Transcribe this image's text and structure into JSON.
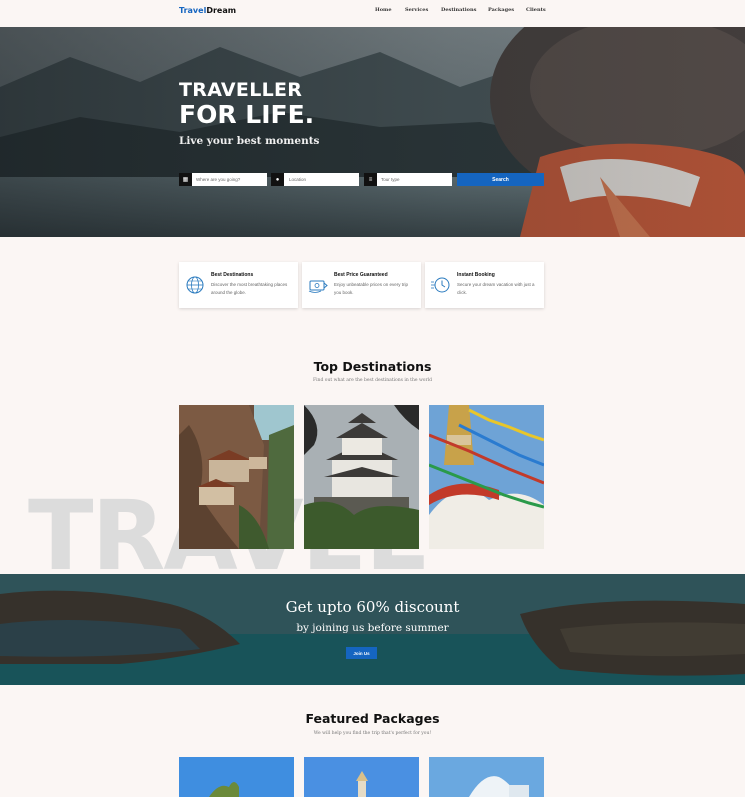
{
  "nav": {
    "logo_part1": "Travel",
    "logo_part2": "Dream",
    "items": [
      "Home",
      "Services",
      "Destinations",
      "Packages",
      "Clients"
    ]
  },
  "hero": {
    "title_line1": "TRAVELLER",
    "title_line2": "FOR LIFE.",
    "subtitle": "Live your best moments",
    "search": {
      "destination_placeholder": "Where are you going?",
      "location_placeholder": "Location",
      "tour_type_placeholder": "Tour type",
      "button_label": "Search"
    }
  },
  "features": [
    {
      "title": "Best Destinations",
      "description": "Discover the most breathtaking places around the globe.",
      "icon": "globe-icon"
    },
    {
      "title": "Best Price Guaranteed",
      "description": "Enjoy unbeatable prices on every trip you book.",
      "icon": "price-tag-icon"
    },
    {
      "title": "Instant Booking",
      "description": "Secure your dream vacation with just a click.",
      "icon": "clock-icon"
    }
  ],
  "top_destinations": {
    "title": "Top Destinations",
    "subtitle": "Find out what are the best destinations in the world",
    "background_word": "TRAVEL",
    "images": [
      "cliff-monastery-image",
      "japanese-castle-image",
      "stupa-prayer-flags-image"
    ]
  },
  "promo": {
    "line1": "Get upto 60% discount",
    "line2": "by joining us before summer",
    "button_label": "Join Us"
  },
  "featured_packages": {
    "title": "Featured Packages",
    "subtitle": "We will help you find the trip that's perfect for you!"
  },
  "colors": {
    "accent": "#1565c0",
    "background": "#fbf6f4"
  }
}
